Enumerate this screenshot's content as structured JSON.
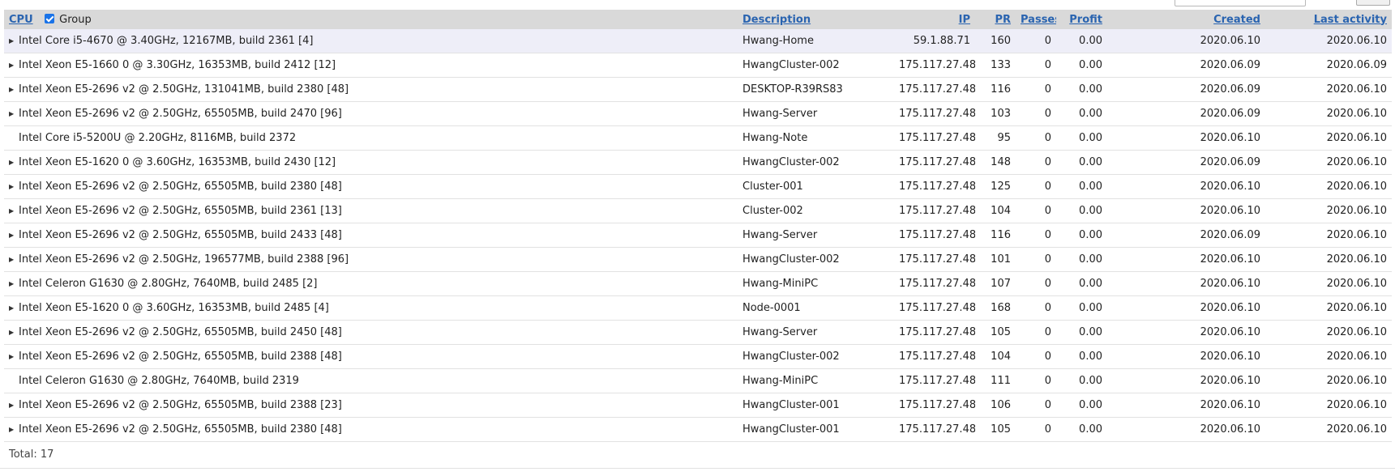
{
  "header": {
    "cpu": "CPU",
    "group": "Group",
    "description": "Description",
    "ip": "IP",
    "pr": "PR",
    "passes": "Passes",
    "profit": "Profit",
    "created": "Created",
    "last_activity": "Last activity"
  },
  "rows": [
    {
      "cpu": "Intel Core i5-4670 @ 3.40GHz, 12167MB, build 2361 [4]",
      "description": "Hwang-Home",
      "ip": "59.1.88.71",
      "pr": "160",
      "passes": "0",
      "profit": "0.00",
      "created": "2020.06.10",
      "last": "2020.06.10"
    },
    {
      "cpu": "Intel Xeon E5-1660 0 @ 3.30GHz, 16353MB, build 2412 [12]",
      "description": "HwangCluster-002",
      "ip": "175.117.27.48",
      "pr": "133",
      "passes": "0",
      "profit": "0.00",
      "created": "2020.06.09",
      "last": "2020.06.09"
    },
    {
      "cpu": "Intel Xeon E5-2696 v2 @ 2.50GHz, 131041MB, build 2380 [48]",
      "description": "DESKTOP-R39RS83",
      "ip": "175.117.27.48",
      "pr": "116",
      "passes": "0",
      "profit": "0.00",
      "created": "2020.06.09",
      "last": "2020.06.10"
    },
    {
      "cpu": "Intel Xeon E5-2696 v2 @ 2.50GHz, 65505MB, build 2470 [96]",
      "description": "Hwang-Server",
      "ip": "175.117.27.48",
      "pr": "103",
      "passes": "0",
      "profit": "0.00",
      "created": "2020.06.09",
      "last": "2020.06.10"
    },
    {
      "cpu": "Intel Core i5-5200U @ 2.20GHz, 8116MB, build 2372",
      "description": "Hwang-Note",
      "ip": "175.117.27.48",
      "pr": "95",
      "passes": "0",
      "profit": "0.00",
      "created": "2020.06.10",
      "last": "2020.06.10"
    },
    {
      "cpu": "Intel Xeon E5-1620 0 @ 3.60GHz, 16353MB, build 2430 [12]",
      "description": "HwangCluster-002",
      "ip": "175.117.27.48",
      "pr": "148",
      "passes": "0",
      "profit": "0.00",
      "created": "2020.06.09",
      "last": "2020.06.10"
    },
    {
      "cpu": "Intel Xeon E5-2696 v2 @ 2.50GHz, 65505MB, build 2380 [48]",
      "description": "Cluster-001",
      "ip": "175.117.27.48",
      "pr": "125",
      "passes": "0",
      "profit": "0.00",
      "created": "2020.06.10",
      "last": "2020.06.10"
    },
    {
      "cpu": "Intel Xeon E5-2696 v2 @ 2.50GHz, 65505MB, build 2361 [13]",
      "description": "Cluster-002",
      "ip": "175.117.27.48",
      "pr": "104",
      "passes": "0",
      "profit": "0.00",
      "created": "2020.06.10",
      "last": "2020.06.10"
    },
    {
      "cpu": "Intel Xeon E5-2696 v2 @ 2.50GHz, 65505MB, build 2433 [48]",
      "description": "Hwang-Server",
      "ip": "175.117.27.48",
      "pr": "116",
      "passes": "0",
      "profit": "0.00",
      "created": "2020.06.09",
      "last": "2020.06.10"
    },
    {
      "cpu": "Intel Xeon E5-2696 v2 @ 2.50GHz, 196577MB, build 2388 [96]",
      "description": "HwangCluster-002",
      "ip": "175.117.27.48",
      "pr": "101",
      "passes": "0",
      "profit": "0.00",
      "created": "2020.06.10",
      "last": "2020.06.10"
    },
    {
      "cpu": "Intel Celeron G1630 @ 2.80GHz, 7640MB, build 2485 [2]",
      "description": "Hwang-MiniPC",
      "ip": "175.117.27.48",
      "pr": "107",
      "passes": "0",
      "profit": "0.00",
      "created": "2020.06.10",
      "last": "2020.06.10"
    },
    {
      "cpu": "Intel Xeon E5-1620 0 @ 3.60GHz, 16353MB, build 2485 [4]",
      "description": "Node-0001",
      "ip": "175.117.27.48",
      "pr": "168",
      "passes": "0",
      "profit": "0.00",
      "created": "2020.06.10",
      "last": "2020.06.10"
    },
    {
      "cpu": "Intel Xeon E5-2696 v2 @ 2.50GHz, 65505MB, build 2450 [48]",
      "description": "Hwang-Server",
      "ip": "175.117.27.48",
      "pr": "105",
      "passes": "0",
      "profit": "0.00",
      "created": "2020.06.10",
      "last": "2020.06.10"
    },
    {
      "cpu": "Intel Xeon E5-2696 v2 @ 2.50GHz, 65505MB, build 2388 [48]",
      "description": "HwangCluster-002",
      "ip": "175.117.27.48",
      "pr": "104",
      "passes": "0",
      "profit": "0.00",
      "created": "2020.06.10",
      "last": "2020.06.10"
    },
    {
      "cpu": "Intel Celeron G1630 @ 2.80GHz, 7640MB, build 2319",
      "description": "Hwang-MiniPC",
      "ip": "175.117.27.48",
      "pr": "111",
      "passes": "0",
      "profit": "0.00",
      "created": "2020.06.10",
      "last": "2020.06.10"
    },
    {
      "cpu": "Intel Xeon E5-2696 v2 @ 2.50GHz, 65505MB, build 2388 [23]",
      "description": "HwangCluster-001",
      "ip": "175.117.27.48",
      "pr": "106",
      "passes": "0",
      "profit": "0.00",
      "created": "2020.06.10",
      "last": "2020.06.10"
    },
    {
      "cpu": "Intel Xeon E5-2696 v2 @ 2.50GHz, 65505MB, build 2380 [48]",
      "description": "HwangCluster-001",
      "ip": "175.117.27.48",
      "pr": "105",
      "passes": "0",
      "profit": "0.00",
      "created": "2020.06.10",
      "last": "2020.06.10"
    }
  ],
  "footer": {
    "total": "Total: 17"
  }
}
